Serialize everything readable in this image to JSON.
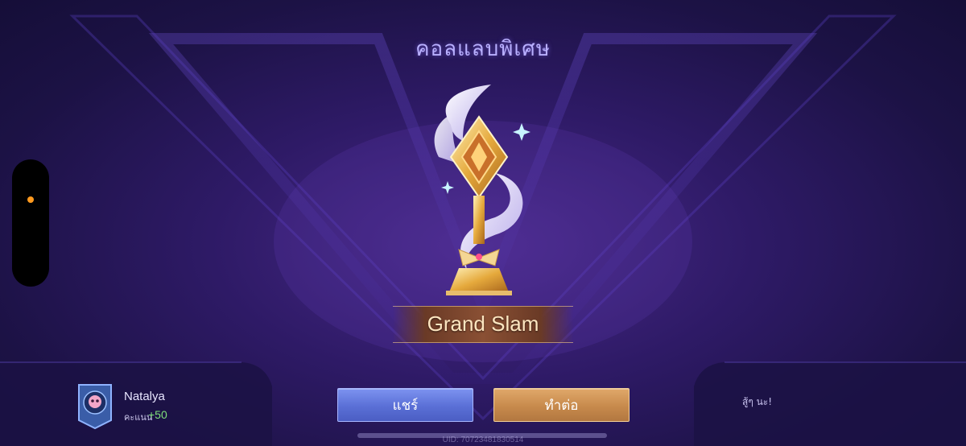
{
  "screen": {
    "title": "คอลแลบพิเศษ",
    "achievement_name": "Grand Slam",
    "uid_text": "UID: 70723481830514"
  },
  "player": {
    "name": "Natalya",
    "score_label": "คะแนน",
    "score_value": "+50",
    "avatar_icon": "skull-badge-icon"
  },
  "buttons": {
    "share_label": "แชร์",
    "continue_label": "ทำต่อ"
  },
  "right_panel": {
    "text": "สู้ๆ นะ!"
  },
  "colors": {
    "title": "#b9b0ff",
    "share_button": "#5a6fd6",
    "continue_button": "#c78a4c",
    "score": "#7fe07a"
  }
}
